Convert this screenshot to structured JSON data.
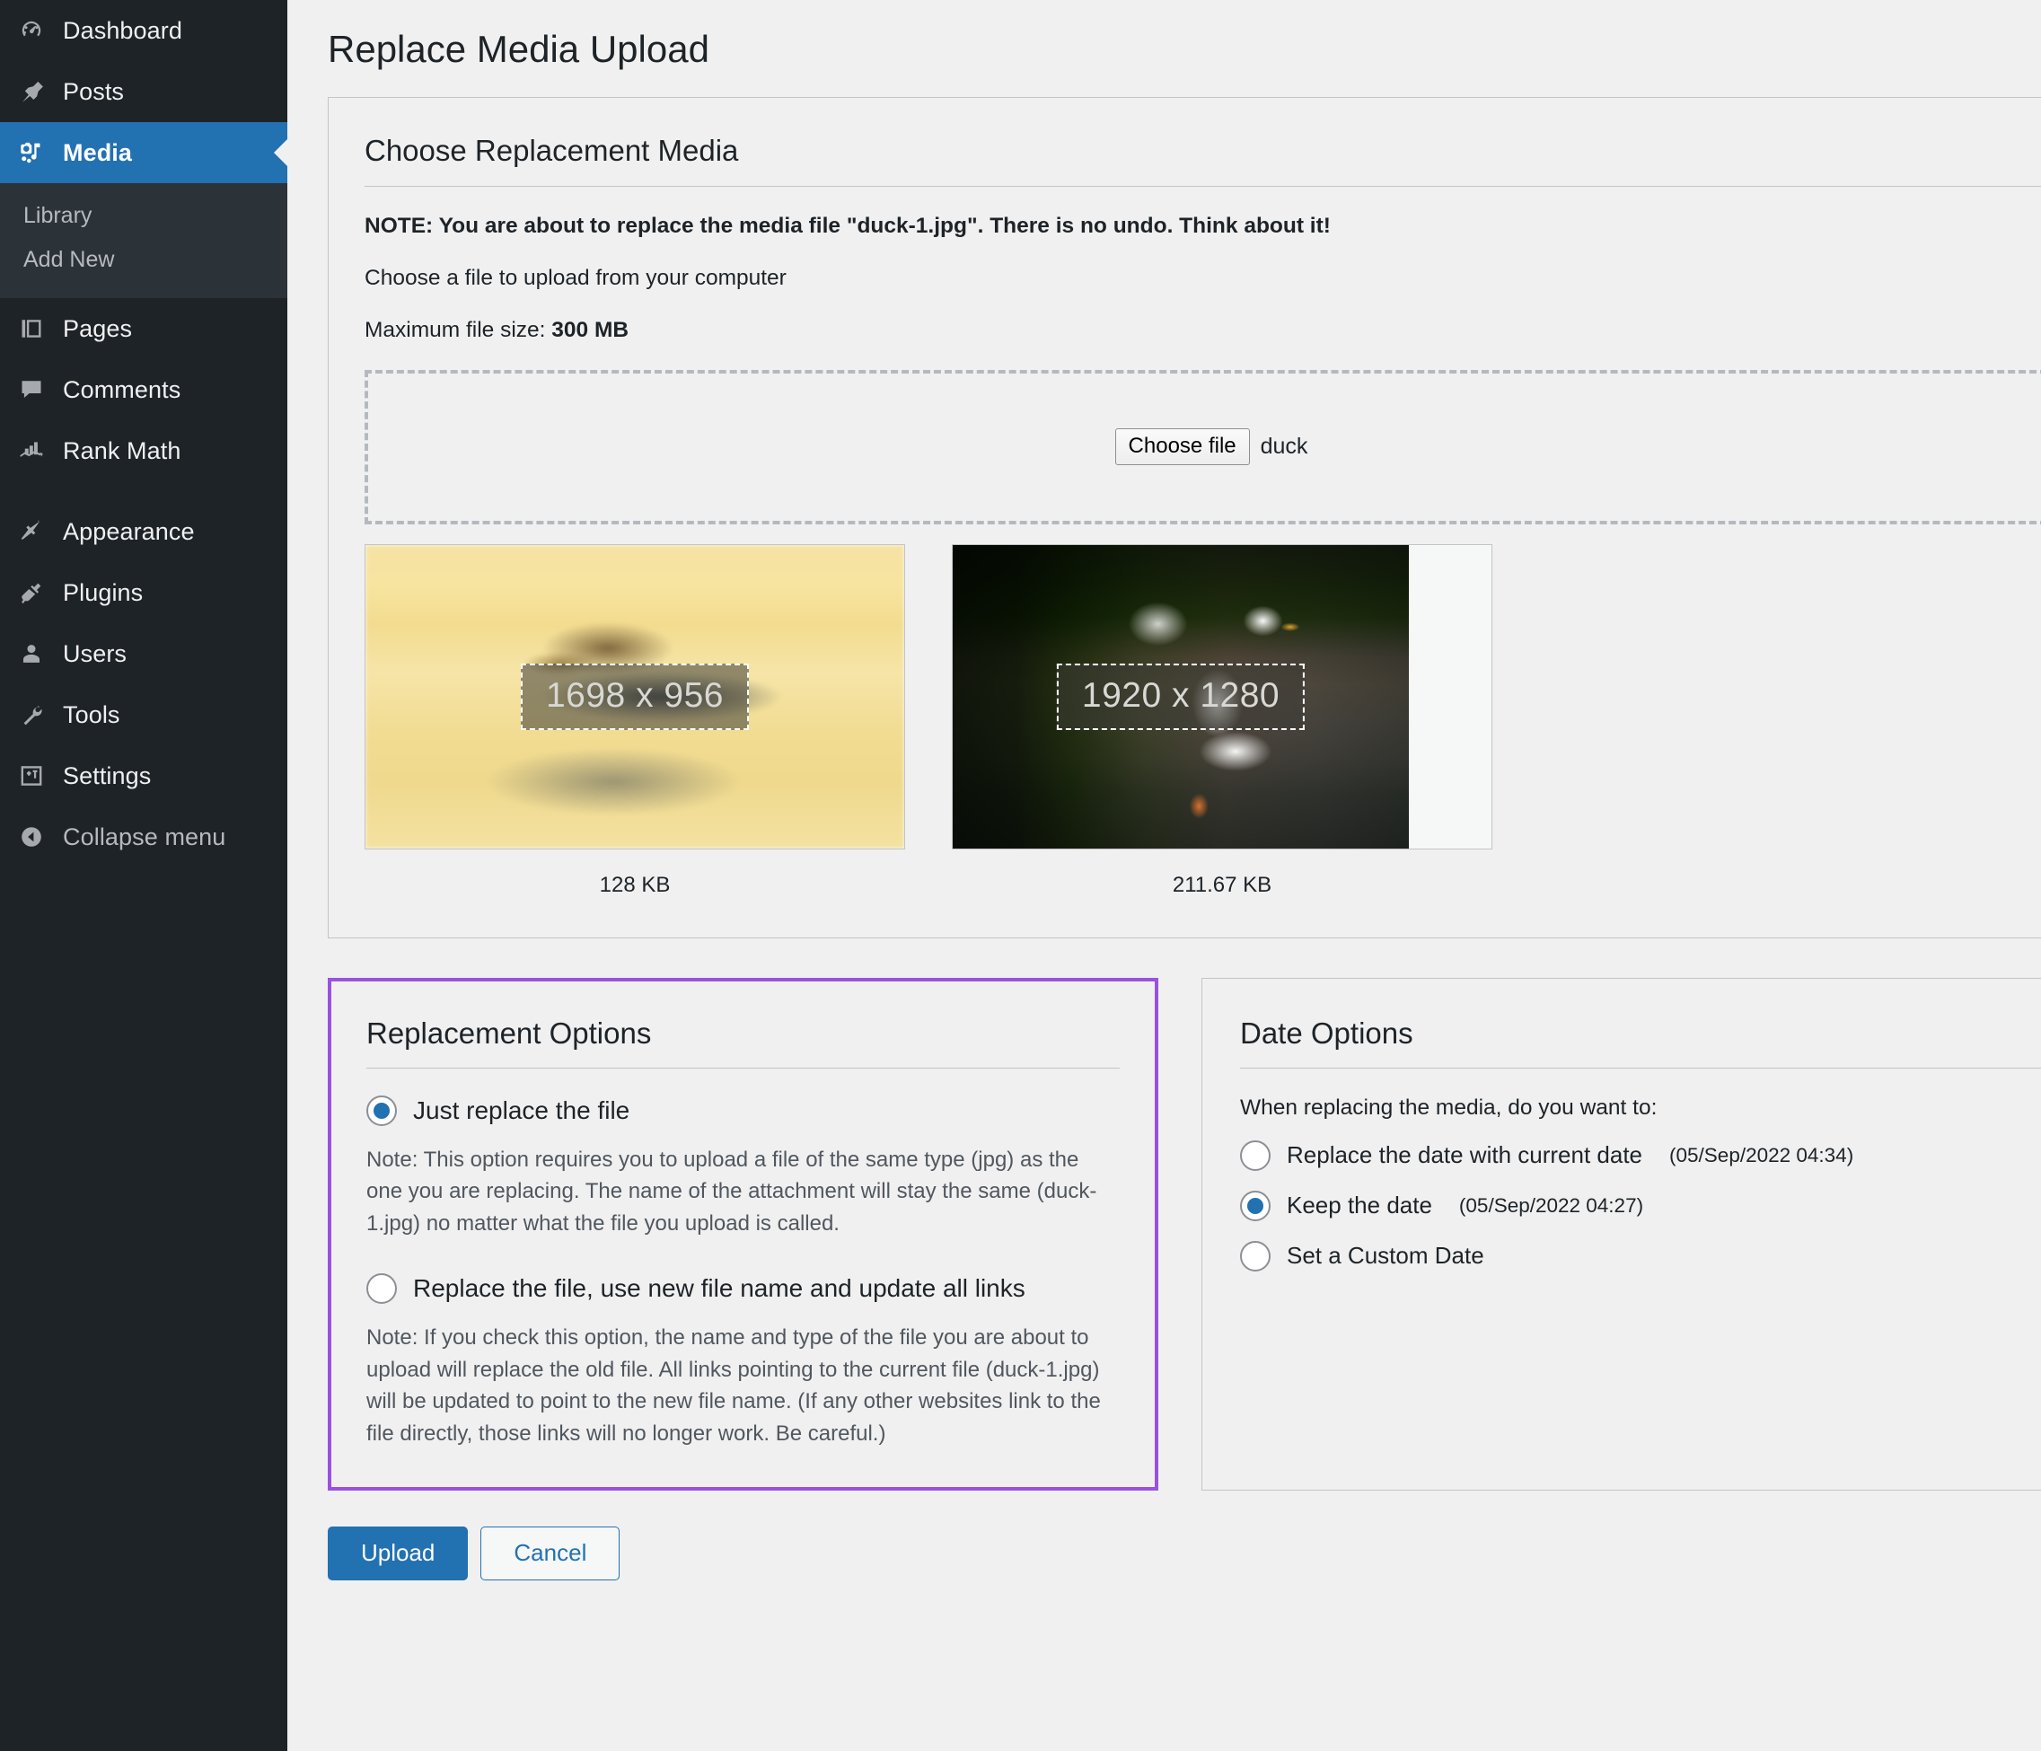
{
  "sidebar": {
    "items": [
      {
        "label": "Dashboard",
        "icon": "dashboard-icon",
        "current": false
      },
      {
        "label": "Posts",
        "icon": "pin-icon",
        "current": false
      },
      {
        "label": "Media",
        "icon": "media-icon",
        "current": true
      },
      {
        "label": "Pages",
        "icon": "pages-icon",
        "current": false
      },
      {
        "label": "Comments",
        "icon": "comments-icon",
        "current": false
      },
      {
        "label": "Rank Math",
        "icon": "chart-arrow-icon",
        "current": false
      },
      {
        "label": "Appearance",
        "icon": "paintbrush-icon",
        "current": false
      },
      {
        "label": "Plugins",
        "icon": "plug-icon",
        "current": false
      },
      {
        "label": "Users",
        "icon": "user-icon",
        "current": false
      },
      {
        "label": "Tools",
        "icon": "wrench-icon",
        "current": false
      },
      {
        "label": "Settings",
        "icon": "sliders-icon",
        "current": false
      },
      {
        "label": "Collapse menu",
        "icon": "collapse-arrow-icon",
        "current": false
      }
    ],
    "submenu": [
      {
        "label": "Library"
      },
      {
        "label": "Add New"
      }
    ],
    "colors": {
      "background": "#1d2327",
      "submenu_background": "#2c3338",
      "current_background": "#2271b1"
    }
  },
  "page": {
    "title": "Replace Media Upload"
  },
  "media_panel": {
    "heading": "Choose Replacement Media",
    "note": "NOTE: You are about to replace the media file \"duck-1.jpg\". There is no undo. Think about it!",
    "instruction": "Choose a file to upload from your computer",
    "max_size_label": "Maximum file size:",
    "max_size_value": "300 MB",
    "file_input": {
      "button_label": "Choose file",
      "file_name": "duck"
    },
    "thumbnails": [
      {
        "dimensions": "1698 x 956",
        "size": "128 KB",
        "alt": "Blurred mallard duck floating on golden water"
      },
      {
        "dimensions": "1920 x 1280",
        "size": "211.67 KB",
        "alt": "White pekin duck flapping its wings on a path"
      }
    ]
  },
  "replacement_options": {
    "heading": "Replacement Options",
    "focus_color": "#9b51e0",
    "options": [
      {
        "label": "Just replace the file",
        "checked": true,
        "note": "Note: This option requires you to upload a file of the same type (jpg) as the one you are replacing. The name of the attachment will stay the same (duck-1.jpg) no matter what the file you upload is called."
      },
      {
        "label": "Replace the file, use new file name and update all links",
        "checked": false,
        "note": "Note: If you check this option, the name and type of the file you are about to upload will replace the old file. All links pointing to the current file (duck-1.jpg) will be updated to point to the new file name. (If any other websites link to the file directly, those links will no longer work. Be careful.)"
      }
    ]
  },
  "date_options": {
    "heading": "Date Options",
    "question": "When replacing the media, do you want to:",
    "options": [
      {
        "label": "Replace the date with current date",
        "date": "(05/Sep/2022 04:34)",
        "checked": false
      },
      {
        "label": "Keep the date",
        "date": "(05/Sep/2022 04:27)",
        "checked": true
      },
      {
        "label": "Set a Custom Date",
        "date": "",
        "checked": false
      }
    ]
  },
  "footer": {
    "upload_label": "Upload",
    "cancel_label": "Cancel",
    "primary_color": "#2271b1"
  }
}
